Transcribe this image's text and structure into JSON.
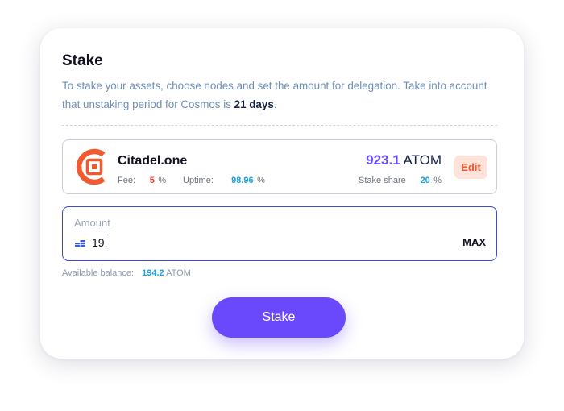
{
  "stake": {
    "title": "Stake",
    "description_1": "To stake your assets, choose nodes and set the amount for delegation. Take into account that unstaking period for Cosmos is ",
    "description_bold": "21 days",
    "description_2": "."
  },
  "node": {
    "name": "Citadel.one",
    "fee_label": "Fee:",
    "fee_value": "5",
    "fee_unit": "%",
    "uptime_label": "Uptime:",
    "uptime_value": "98.96",
    "uptime_unit": "%",
    "amount_value": "923.1",
    "amount_unit": "ATOM",
    "stake_share_label": "Stake share",
    "stake_share_value": "20",
    "stake_share_unit": "%",
    "edit_label": "Edit",
    "logo_icon": "citadel-logo-icon",
    "logo_color": "#f05a2e"
  },
  "amount_field": {
    "label": "Amount",
    "value": "19",
    "max_label": "MAX",
    "icon": "coin-stack-icon"
  },
  "balance": {
    "label": "Available balance:",
    "value": "194.2",
    "unit": "ATOM"
  },
  "stake_button": {
    "label": "Stake",
    "color": "#6a48fb"
  }
}
